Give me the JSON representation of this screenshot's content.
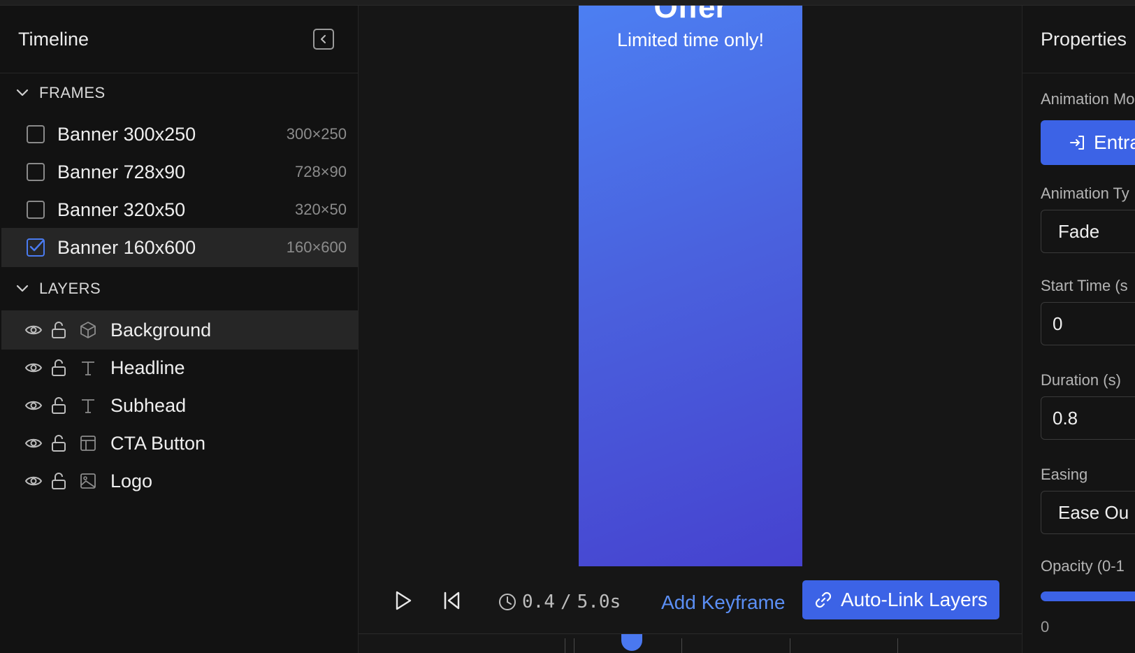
{
  "timeline": {
    "title": "Timeline",
    "frames_heading": "FRAMES",
    "frames": [
      {
        "name": "Banner 300x250",
        "size": "300×250",
        "checked": false
      },
      {
        "name": "Banner 728x90",
        "size": "728×90",
        "checked": false
      },
      {
        "name": "Banner 320x50",
        "size": "320×50",
        "checked": false
      },
      {
        "name": "Banner 160x600",
        "size": "160×600",
        "checked": true
      }
    ],
    "layers_heading": "LAYERS",
    "layers": [
      {
        "name": "Background",
        "type_icon": "cube-icon"
      },
      {
        "name": "Headline",
        "type_icon": "text-icon"
      },
      {
        "name": "Subhead",
        "type_icon": "text-icon"
      },
      {
        "name": "CTA Button",
        "type_icon": "layout-icon"
      },
      {
        "name": "Logo",
        "type_icon": "image-icon"
      }
    ]
  },
  "canvas": {
    "headline": "Offer",
    "subhead": "Limited time only!",
    "gradient_colors": [
      "#4c7ff2",
      "#4642cf"
    ]
  },
  "controls": {
    "current_time": "0.4",
    "separator": "/",
    "total_time": "5.0s",
    "add_keyframe_label": "Add Keyframe",
    "auto_link_label": "Auto-Link Layers"
  },
  "properties": {
    "title": "Properties",
    "animation_mode_label": "Animation Mo",
    "animation_mode_value": "Entra",
    "animation_type_label": "Animation Ty",
    "animation_type_value": "Fade",
    "start_time_label": "Start Time (s",
    "start_time_value": "0",
    "duration_label": "Duration (s)",
    "duration_value": "0.8",
    "easing_label": "Easing",
    "easing_value": "Ease Ou",
    "opacity_label": "Opacity (0-1",
    "opacity_min": "0"
  },
  "colors": {
    "accent": "#3c63e6",
    "link": "#5b8ff5",
    "panel_bg": "#121212"
  }
}
